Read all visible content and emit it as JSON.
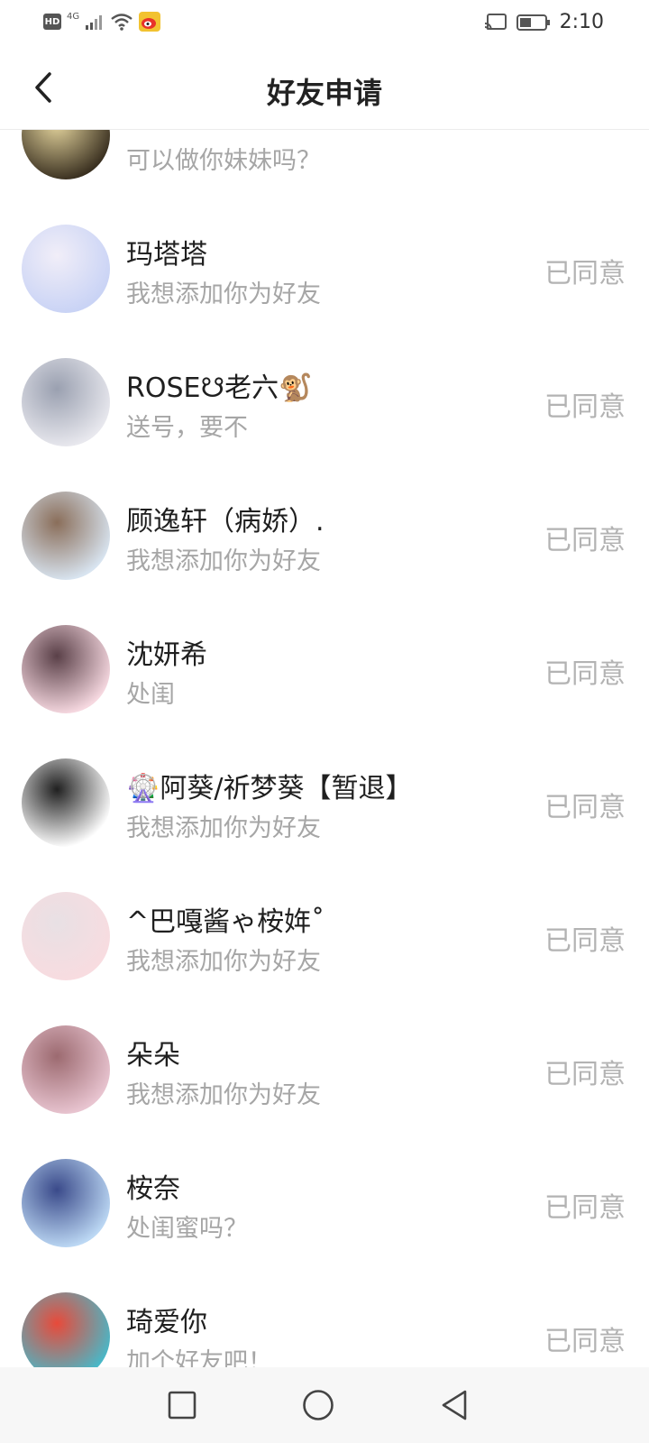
{
  "status_bar": {
    "hd_label": "HD",
    "network_label": "4G",
    "time": "2:10",
    "icons": [
      "signal-icon",
      "wifi-icon",
      "weibo-icon",
      "cast-icon",
      "battery-icon"
    ]
  },
  "header": {
    "title": "好友申请",
    "back_icon": "chevron-left-icon"
  },
  "requests": [
    {
      "name": "",
      "message": "可以做你妹妹吗？",
      "status": "",
      "avatar_colors": [
        "#3a3020",
        "#e8d8a0"
      ]
    },
    {
      "name": "玛塔塔",
      "message": "我想添加你为好友",
      "status": "已同意",
      "avatar_colors": [
        "#c9d3f5",
        "#f1eef8"
      ]
    },
    {
      "name": "ROSE☋老六🐒",
      "message": "送号，要不",
      "status": "已同意",
      "avatar_colors": [
        "#e8e8ee",
        "#9aa0b0"
      ]
    },
    {
      "name": "顾逸轩（病娇）.",
      "message": "我想添加你为好友",
      "status": "已同意",
      "avatar_colors": [
        "#d8e4f0",
        "#8a6e5a"
      ]
    },
    {
      "name": "沈妍希",
      "message": "处闺",
      "status": "已同意",
      "avatar_colors": [
        "#f6d8e0",
        "#5a4048"
      ]
    },
    {
      "name": "🎡阿葵/祈梦葵【暂退】",
      "message": "我想添加你为好友",
      "status": "已同意",
      "avatar_colors": [
        "#ffffff",
        "#202020"
      ]
    },
    {
      "name": "^巴嘎酱ゃ桉姩˚",
      "message": "我想添加你为好友",
      "status": "已同意",
      "avatar_colors": [
        "#f8dce0",
        "#e8e0e4"
      ]
    },
    {
      "name": "朵朵",
      "message": "我想添加你为好友",
      "status": "已同意",
      "avatar_colors": [
        "#e8c4d0",
        "#9c6a70"
      ]
    },
    {
      "name": "桉奈",
      "message": "处闺蜜吗？",
      "status": "已同意",
      "avatar_colors": [
        "#bcd8f4",
        "#3a4a8a"
      ]
    },
    {
      "name": "琦爱你",
      "message": "加个好友吧！",
      "status": "已同意",
      "avatar_colors": [
        "#48b8c8",
        "#e84a3a"
      ]
    }
  ],
  "nav_bar": {
    "icons": [
      "recent-apps-icon",
      "home-icon",
      "back-triangle-icon"
    ]
  }
}
